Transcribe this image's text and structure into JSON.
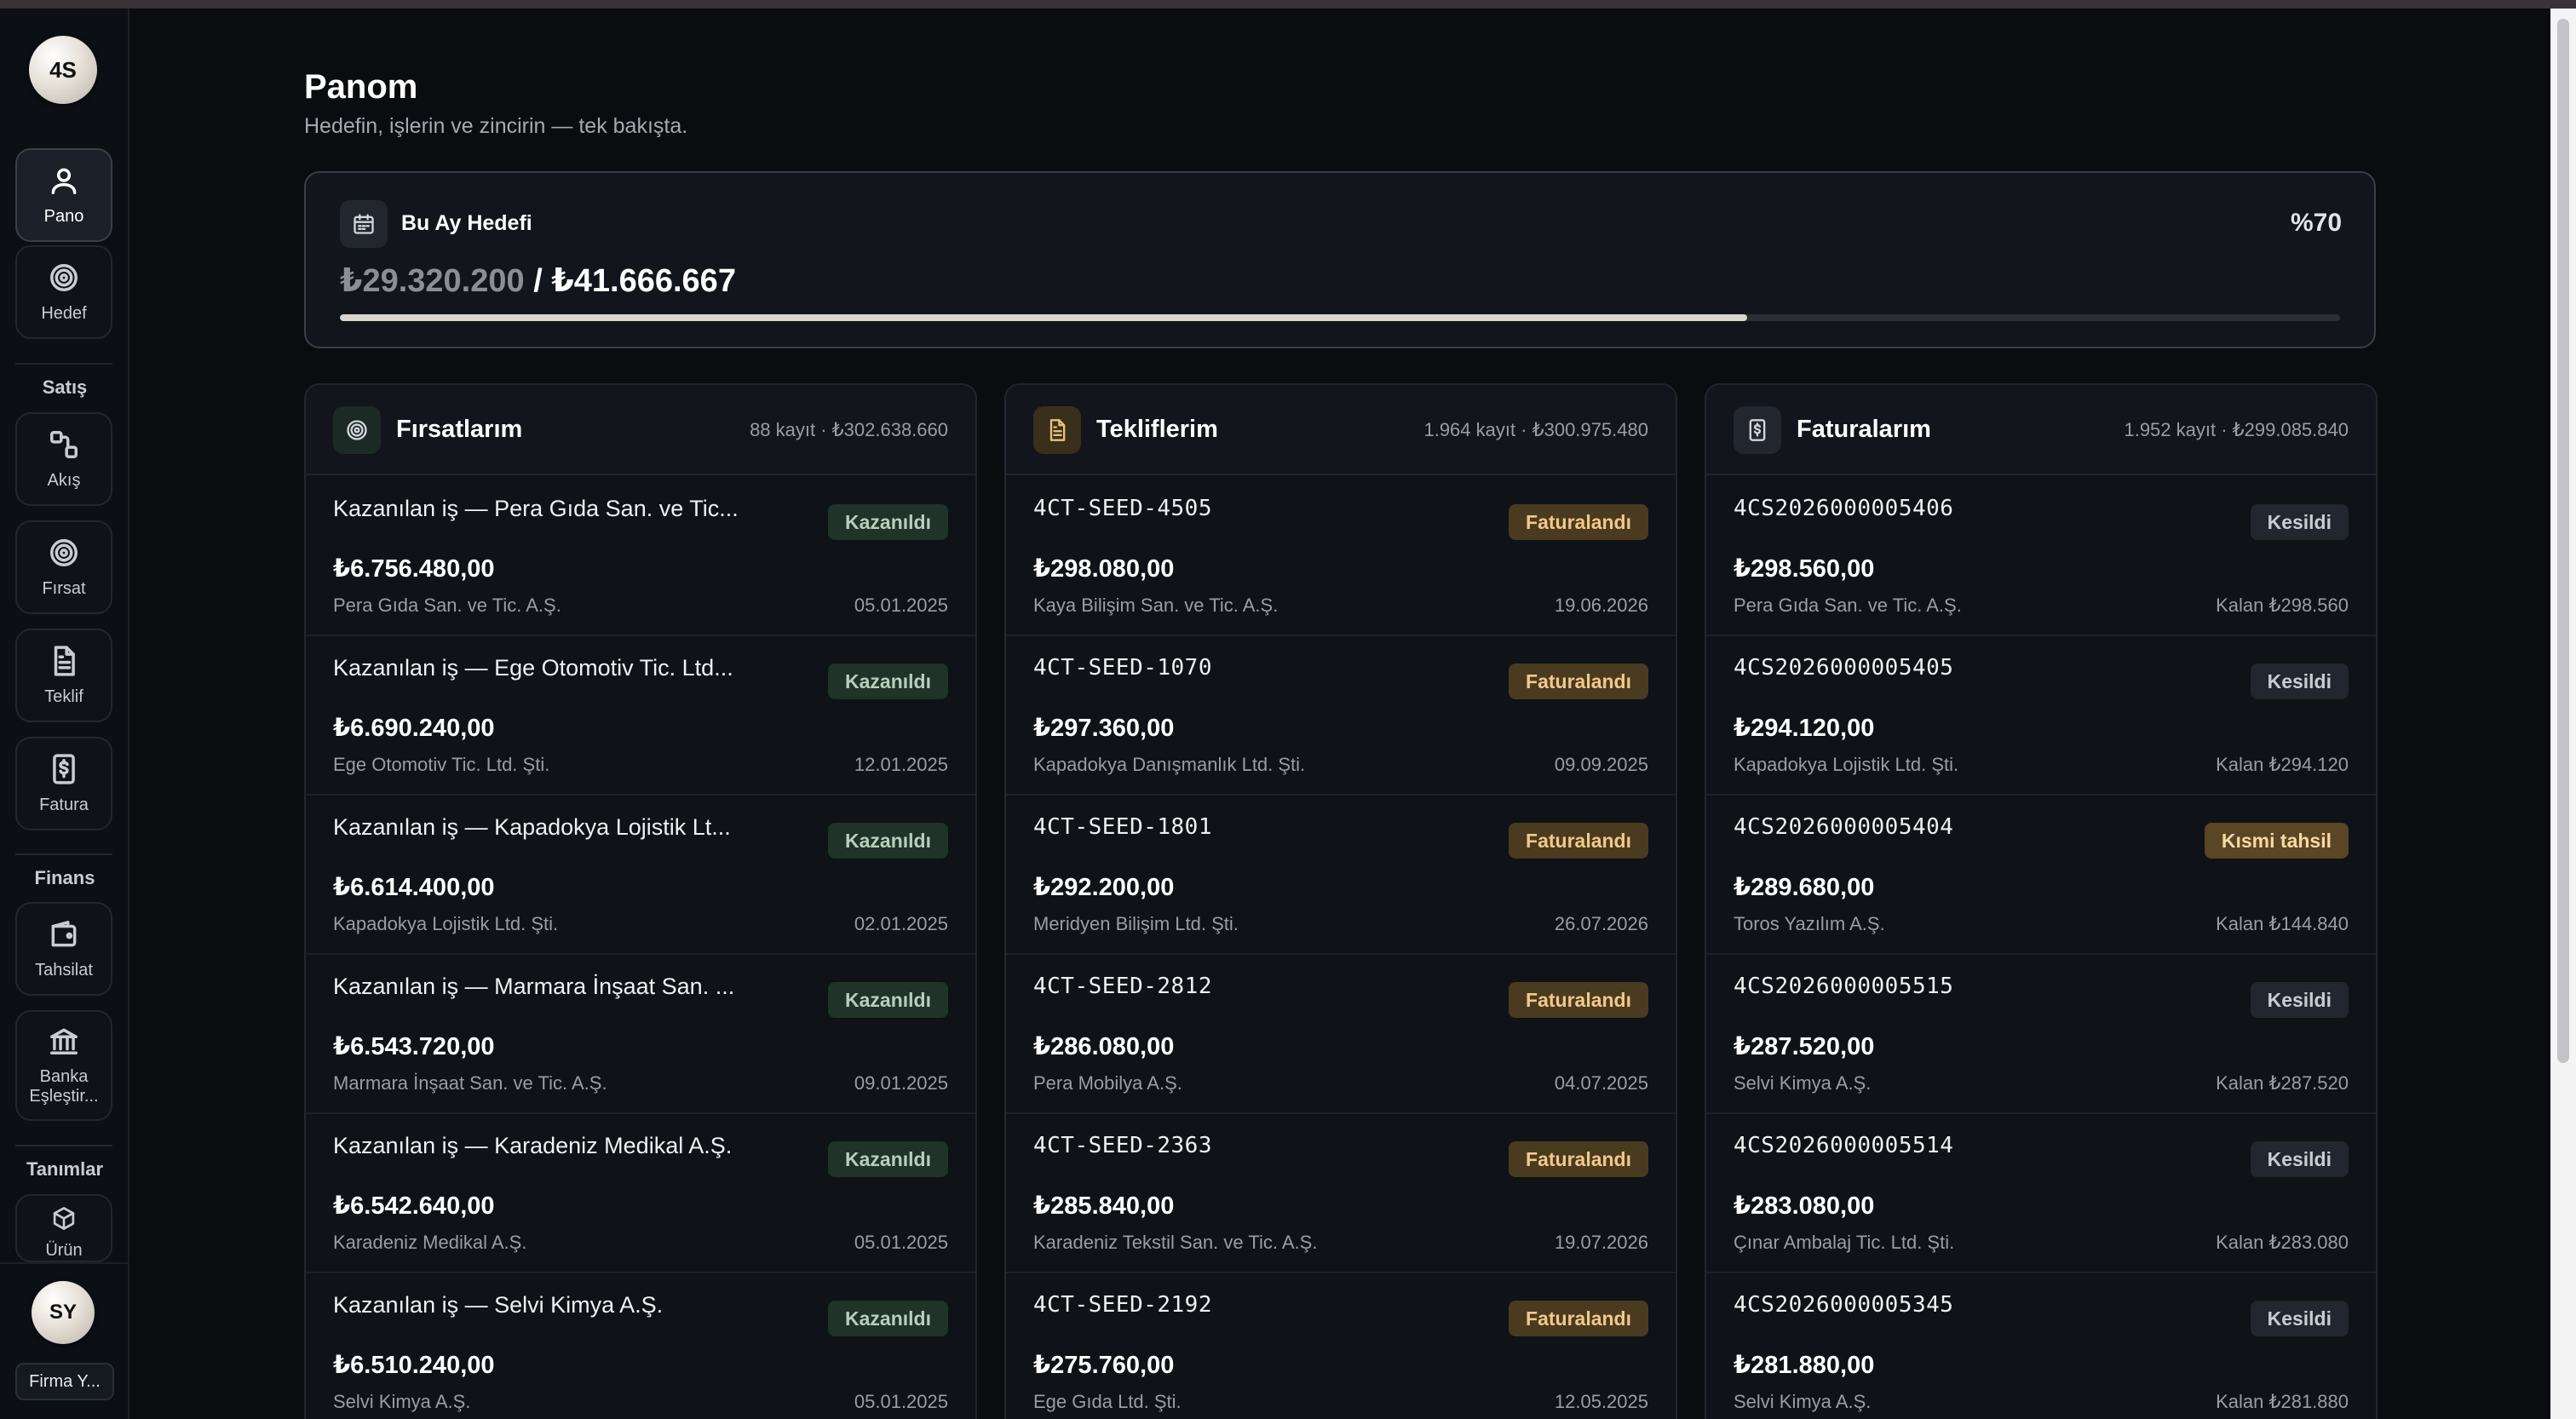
{
  "sidebar": {
    "top_avatar": "4S",
    "nav": [
      {
        "label": "Pano",
        "icon": "user-icon",
        "active": true
      },
      {
        "label": "Hedef",
        "icon": "target-icon"
      }
    ],
    "sections": {
      "sales": {
        "title": "Satış",
        "items": [
          {
            "label": "Akış",
            "icon": "flow-icon"
          },
          {
            "label": "Fırsat",
            "icon": "target-icon"
          },
          {
            "label": "Teklif",
            "icon": "document-icon"
          },
          {
            "label": "Fatura",
            "icon": "invoice-icon"
          }
        ]
      },
      "finance": {
        "title": "Finans",
        "items": [
          {
            "label": "Tahsilat",
            "icon": "wallet-icon"
          },
          {
            "label": "Banka Eşleştir...",
            "icon": "bank-icon"
          }
        ]
      },
      "definitions": {
        "title": "Tanımlar",
        "items": [
          {
            "label": "Ürün",
            "icon": "box-icon"
          }
        ]
      }
    },
    "user_avatar": "SY",
    "company_label": "Firma Y..."
  },
  "header": {
    "title": "Panom",
    "subtitle": "Hedefin, işlerin ve zincirin — tek bakışta."
  },
  "goal": {
    "label": "Bu Ay Hedefi",
    "current": "₺29.320.200",
    "separator": " / ",
    "target": "₺41.666.667",
    "percent_label": "%70",
    "progress_fraction": 0.7035
  },
  "cards": [
    {
      "title": "Fırsatlarım",
      "icon": "target-icon",
      "meta": "88 kayıt · ₺302.638.660",
      "rows": [
        {
          "title": "Kazanılan iş — Pera Gıda San. ve Tic...",
          "badge": "Kazanıldı",
          "amount": "₺6.756.480,00",
          "sub": "Pera Gıda San. ve Tic. A.Ş.",
          "right": "05.01.2025"
        },
        {
          "title": "Kazanılan iş — Ege Otomotiv Tic. Ltd...",
          "badge": "Kazanıldı",
          "amount": "₺6.690.240,00",
          "sub": "Ege Otomotiv Tic. Ltd. Şti.",
          "right": "12.01.2025"
        },
        {
          "title": "Kazanılan iş — Kapadokya Lojistik Lt...",
          "badge": "Kazanıldı",
          "amount": "₺6.614.400,00",
          "sub": "Kapadokya Lojistik Ltd. Şti.",
          "right": "02.01.2025"
        },
        {
          "title": "Kazanılan iş — Marmara İnşaat San. ...",
          "badge": "Kazanıldı",
          "amount": "₺6.543.720,00",
          "sub": "Marmara İnşaat San. ve Tic. A.Ş.",
          "right": "09.01.2025"
        },
        {
          "title": "Kazanılan iş — Karadeniz Medikal A.Ş.",
          "badge": "Kazanıldı",
          "amount": "₺6.542.640,00",
          "sub": "Karadeniz Medikal A.Ş.",
          "right": "05.01.2025"
        },
        {
          "title": "Kazanılan iş — Selvi Kimya A.Ş.",
          "badge": "Kazanıldı",
          "amount": "₺6.510.240,00",
          "sub": "Selvi Kimya A.Ş.",
          "right": "05.01.2025"
        }
      ]
    },
    {
      "title": "Tekliflerim",
      "icon": "document-icon",
      "meta": "1.964 kayıt · ₺300.975.480",
      "rows": [
        {
          "title": "4CT-SEED-4505",
          "badge": "Faturalandı",
          "amount": "₺298.080,00",
          "sub": "Kaya Bilişim San. ve Tic. A.Ş.",
          "right": "19.06.2026"
        },
        {
          "title": "4CT-SEED-1070",
          "badge": "Faturalandı",
          "amount": "₺297.360,00",
          "sub": "Kapadokya Danışmanlık Ltd. Şti.",
          "right": "09.09.2025"
        },
        {
          "title": "4CT-SEED-1801",
          "badge": "Faturalandı",
          "amount": "₺292.200,00",
          "sub": "Meridyen Bilişim Ltd. Şti.",
          "right": "26.07.2026"
        },
        {
          "title": "4CT-SEED-2812",
          "badge": "Faturalandı",
          "amount": "₺286.080,00",
          "sub": "Pera Mobilya A.Ş.",
          "right": "04.07.2025"
        },
        {
          "title": "4CT-SEED-2363",
          "badge": "Faturalandı",
          "amount": "₺285.840,00",
          "sub": "Karadeniz Tekstil San. ve Tic. A.Ş.",
          "right": "19.07.2026"
        },
        {
          "title": "4CT-SEED-2192",
          "badge": "Faturalandı",
          "amount": "₺275.760,00",
          "sub": "Ege Gıda Ltd. Şti.",
          "right": "12.05.2025"
        }
      ]
    },
    {
      "title": "Faturalarım",
      "icon": "invoice-icon",
      "meta": "1.952 kayıt · ₺299.085.840",
      "rows": [
        {
          "title": "4CS2026000005406",
          "badge": "Kesildi",
          "amount": "₺298.560,00",
          "sub": "Pera Gıda San. ve Tic. A.Ş.",
          "right": "Kalan ₺298.560"
        },
        {
          "title": "4CS2026000005405",
          "badge": "Kesildi",
          "amount": "₺294.120,00",
          "sub": "Kapadokya Lojistik Ltd. Şti.",
          "right": "Kalan ₺294.120"
        },
        {
          "title": "4CS2026000005404",
          "badge": "Kısmi tahsil",
          "amount": "₺289.680,00",
          "sub": "Toros Yazılım A.Ş.",
          "right": "Kalan ₺144.840"
        },
        {
          "title": "4CS2026000005515",
          "badge": "Kesildi",
          "amount": "₺287.520,00",
          "sub": "Selvi Kimya A.Ş.",
          "right": "Kalan ₺287.520"
        },
        {
          "title": "4CS2026000005514",
          "badge": "Kesildi",
          "amount": "₺283.080,00",
          "sub": "Çınar Ambalaj Tic. Ltd. Şti.",
          "right": "Kalan ₺283.080"
        },
        {
          "title": "4CS2026000005345",
          "badge": "Kesildi",
          "amount": "₺281.880,00",
          "sub": "Selvi Kimya A.Ş.",
          "right": "Kalan ₺281.880"
        }
      ]
    }
  ],
  "colors": {
    "background": "#0a0c10",
    "badge_won": "#1f3328",
    "badge_invoiced": "#4a3a20",
    "badge_issued": "#22262e",
    "badge_partial": "#5a4524"
  }
}
